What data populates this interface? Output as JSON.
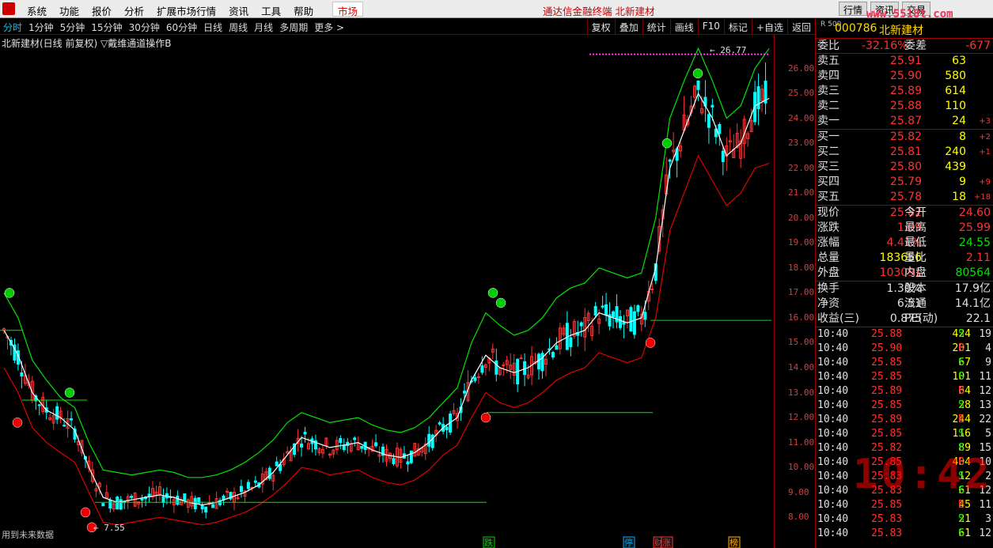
{
  "menu": {
    "items": [
      "系统",
      "功能",
      "报价",
      "分析",
      "扩展市场行情",
      "资讯",
      "工具",
      "帮助"
    ],
    "market": "市场",
    "title": "通达信金融终端  北新建材",
    "right_buttons": [
      "行情",
      "资讯",
      "交易"
    ],
    "watermark": "www.5518t.com"
  },
  "toolbar": {
    "periods": [
      "分时",
      "1分钟",
      "5分钟",
      "15分钟",
      "30分钟",
      "60分钟",
      "日线",
      "周线",
      "月线",
      "多周期",
      "更多 >"
    ],
    "active_period": "分时",
    "tools": [
      "复权",
      "叠加",
      "统计",
      "画线",
      "F10",
      "标记",
      "+自选",
      "返回"
    ]
  },
  "chart": {
    "label": "北新建材(日线 前复权) ▽戴维通道操作B",
    "future_note": "用到未来数据",
    "high_label": "26.77",
    "low_label": "7.55",
    "bottom_markers": [
      "跌",
      "停",
      "财",
      "涨",
      "榜"
    ],
    "y_ticks": [
      "26.00",
      "25.00",
      "24.00",
      "23.00",
      "22.00",
      "21.00",
      "20.00",
      "19.00",
      "18.00",
      "17.00",
      "16.00",
      "15.00",
      "14.00",
      "13.00",
      "12.00",
      "11.00",
      "10.00",
      "9.00",
      "8.00"
    ],
    "colors": {
      "up": "#ff3333",
      "down": "#00ffff",
      "upper_band": "#00e600",
      "lower_band": "#e00000",
      "mid_line": "#ffffff"
    }
  },
  "chart_data": {
    "type": "line",
    "title": "北新建材(日线 前复权) ▽戴维通道操作B",
    "xlabel": "",
    "ylabel": "",
    "ylim": [
      7.5,
      27.0
    ],
    "series": [
      {
        "values": [
          15.5,
          14.5,
          13.0,
          12.3,
          12.0,
          11.5,
          10.0,
          8.8,
          8.6,
          8.7,
          8.8,
          8.9,
          8.8,
          8.6,
          8.5,
          8.6,
          8.8,
          9.0,
          9.3,
          9.8,
          10.5,
          11.2,
          11.0,
          10.8,
          10.9,
          11.0,
          10.7,
          10.5,
          10.4,
          10.6,
          11.0,
          11.6,
          12.0,
          13.5,
          14.5,
          14.0,
          13.8,
          14.0,
          14.4,
          15.0,
          15.3,
          15.5,
          16.2,
          16.0,
          15.8,
          16.0,
          18.0,
          22.0,
          23.5,
          25.0,
          24.0,
          22.5,
          23.0,
          24.5,
          24.8
        ]
      },
      {
        "values": [
          17.0,
          16.0,
          14.3,
          13.5,
          12.8,
          12.4,
          11.0,
          9.9,
          9.8,
          9.7,
          9.8,
          9.9,
          9.8,
          9.6,
          9.6,
          9.7,
          9.9,
          10.2,
          10.6,
          11.1,
          11.8,
          12.2,
          12.0,
          11.8,
          11.9,
          12.0,
          11.7,
          11.5,
          11.4,
          11.6,
          12.0,
          12.6,
          13.2,
          15.0,
          16.2,
          15.7,
          15.3,
          15.5,
          16.0,
          16.8,
          17.2,
          17.4,
          18.0,
          17.8,
          17.6,
          17.8,
          20.0,
          24.0,
          25.5,
          26.8,
          25.5,
          24.0,
          24.5,
          26.0,
          26.8
        ]
      },
      {
        "values": [
          14.0,
          13.0,
          11.6,
          11.0,
          10.6,
          10.2,
          9.0,
          7.8,
          7.7,
          7.8,
          7.9,
          8.0,
          7.9,
          7.8,
          7.7,
          7.8,
          8.0,
          8.2,
          8.5,
          8.9,
          9.4,
          10.0,
          9.9,
          9.7,
          9.8,
          9.9,
          9.6,
          9.4,
          9.3,
          9.5,
          9.9,
          10.5,
          10.9,
          12.0,
          13.0,
          12.6,
          12.4,
          12.6,
          13.0,
          13.5,
          13.8,
          14.0,
          14.6,
          14.4,
          14.2,
          14.4,
          16.0,
          19.5,
          21.0,
          22.5,
          21.5,
          20.5,
          21.0,
          22.0,
          22.2
        ]
      }
    ]
  },
  "quote": {
    "r_label": "R 500",
    "code": "000786",
    "name": "北新建材",
    "weibi_label": "委比",
    "weibi": "-32.16%",
    "weicha_label": "委差",
    "weicha": "-677",
    "sells": [
      {
        "label": "卖五",
        "price": "25.91",
        "vol": "63",
        "chg": ""
      },
      {
        "label": "卖四",
        "price": "25.90",
        "vol": "580",
        "chg": ""
      },
      {
        "label": "卖三",
        "price": "25.89",
        "vol": "614",
        "chg": ""
      },
      {
        "label": "卖二",
        "price": "25.88",
        "vol": "110",
        "chg": ""
      },
      {
        "label": "卖一",
        "price": "25.87",
        "vol": "24",
        "chg": "+3"
      }
    ],
    "buys": [
      {
        "label": "买一",
        "price": "25.82",
        "vol": "8",
        "chg": "+2"
      },
      {
        "label": "买二",
        "price": "25.81",
        "vol": "240",
        "chg": "+1"
      },
      {
        "label": "买三",
        "price": "25.80",
        "vol": "439",
        "chg": ""
      },
      {
        "label": "买四",
        "price": "25.79",
        "vol": "9",
        "chg": "+9"
      },
      {
        "label": "买五",
        "price": "25.78",
        "vol": "18",
        "chg": "+18"
      }
    ],
    "stats": [
      {
        "l1": "现价",
        "v1": "25.82",
        "c1": "red",
        "l2": "今开",
        "v2": "24.60",
        "c2": "red"
      },
      {
        "l1": "涨跌",
        "v1": "1.09",
        "c1": "red",
        "l2": "最高",
        "v2": "25.99",
        "c2": "red"
      },
      {
        "l1": "涨幅",
        "v1": "4.41%",
        "c1": "red",
        "l2": "最低",
        "v2": "24.55",
        "c2": "green"
      },
      {
        "l1": "总量",
        "v1": "183656",
        "c1": "yel",
        "l2": "量比",
        "v2": "2.11",
        "c2": "red"
      },
      {
        "l1": "外盘",
        "v1": "103091",
        "c1": "red",
        "l2": "内盘",
        "v2": "80564",
        "c2": "green"
      }
    ],
    "stats2": [
      {
        "l1": "换手",
        "v1": "1.30%",
        "l2": "股本",
        "v2": "17.9亿"
      },
      {
        "l1": "净资",
        "v1": "6.51",
        "l2": "流通",
        "v2": "14.1亿"
      },
      {
        "l1": "收益(三)",
        "v1": "0.875",
        "l2": "PE(动)",
        "v2": "22.1"
      }
    ],
    "ticks": [
      {
        "t": "10:40",
        "p": "25.88",
        "v": "424",
        "bs": "S",
        "n": "19"
      },
      {
        "t": "10:40",
        "p": "25.90",
        "v": "201",
        "bs": "B",
        "n": "4"
      },
      {
        "t": "10:40",
        "p": "25.85",
        "v": "67",
        "bs": "S",
        "n": "9"
      },
      {
        "t": "10:40",
        "p": "25.85",
        "v": "101",
        "bs": "S",
        "n": "11"
      },
      {
        "t": "10:40",
        "p": "25.89",
        "v": "64",
        "bs": "B",
        "n": "12"
      },
      {
        "t": "10:40",
        "p": "25.85",
        "v": "28",
        "bs": "S",
        "n": "13"
      },
      {
        "t": "10:40",
        "p": "25.89",
        "v": "244",
        "bs": "B",
        "n": "22"
      },
      {
        "t": "10:40",
        "p": "25.85",
        "v": "116",
        "bs": "S",
        "n": "5"
      },
      {
        "t": "10:40",
        "p": "25.82",
        "v": "89",
        "bs": "S",
        "n": "15"
      },
      {
        "t": "10:40",
        "p": "25.85",
        "v": "404",
        "bs": "B",
        "n": "10"
      },
      {
        "t": "10:40",
        "p": "25.83",
        "v": "12",
        "bs": "S",
        "n": "2"
      },
      {
        "t": "10:40",
        "p": "25.83",
        "v": "61",
        "bs": "S",
        "n": "12"
      },
      {
        "t": "10:40",
        "p": "25.85",
        "v": "45",
        "bs": "B",
        "n": "11"
      },
      {
        "t": "10:40",
        "p": "25.83",
        "v": "21",
        "bs": "S",
        "n": "3"
      },
      {
        "t": "10:40",
        "p": "25.83",
        "v": "61",
        "bs": "S",
        "n": "12"
      }
    ],
    "clock": "10:42"
  }
}
